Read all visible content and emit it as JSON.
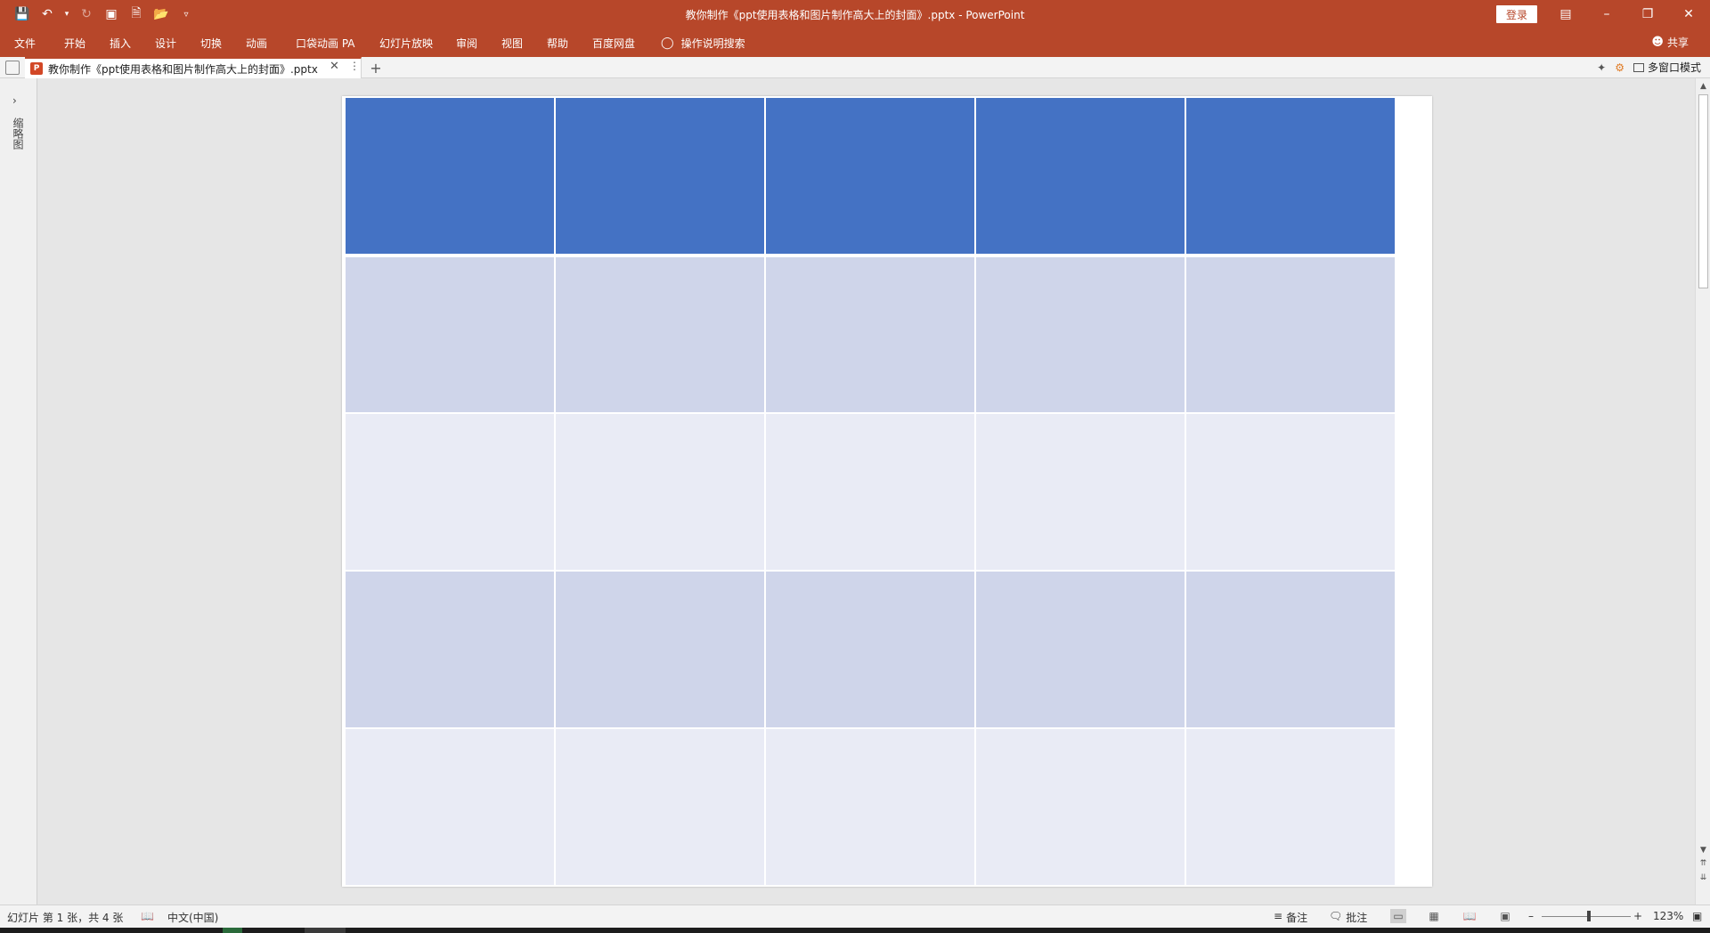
{
  "window": {
    "title": "教你制作《ppt使用表格和图片制作高大上的封面》.pptx  -  PowerPoint",
    "login_label": "登录"
  },
  "ribbon": {
    "tabs": [
      "文件",
      "开始",
      "插入",
      "设计",
      "切换",
      "动画",
      "口袋动画 PA",
      "幻灯片放映",
      "审阅",
      "视图",
      "帮助",
      "百度网盘"
    ],
    "tell_me": "操作说明搜索",
    "share": "共享"
  },
  "doc_tab": {
    "label": "教你制作《ppt使用表格和图片制作高大上的封面》.pptx",
    "multi_window": "多窗口模式"
  },
  "thumbnail_pane": {
    "label": "缩略图"
  },
  "slide": {
    "table": {
      "columns": 5,
      "rows": [
        {
          "style": "header",
          "cells": [
            "",
            "",
            "",
            "",
            ""
          ]
        },
        {
          "style": "band",
          "cells": [
            "",
            "",
            "",
            "",
            ""
          ]
        },
        {
          "style": "plain",
          "cells": [
            "",
            "",
            "",
            "",
            ""
          ]
        },
        {
          "style": "band",
          "cells": [
            "",
            "",
            "",
            "",
            ""
          ]
        },
        {
          "style": "plain",
          "cells": [
            "",
            "",
            "",
            "",
            ""
          ]
        }
      ],
      "colors": {
        "header": "#4472c4",
        "band": "#cfd5ea",
        "plain": "#e9ebf5"
      }
    }
  },
  "status": {
    "slide_info": "幻灯片 第 1 张，共 4 张",
    "language": "中文(中国)",
    "notes": "备注",
    "comments": "批注",
    "zoom": "123%"
  },
  "colors": {
    "accent": "#b7472a"
  }
}
